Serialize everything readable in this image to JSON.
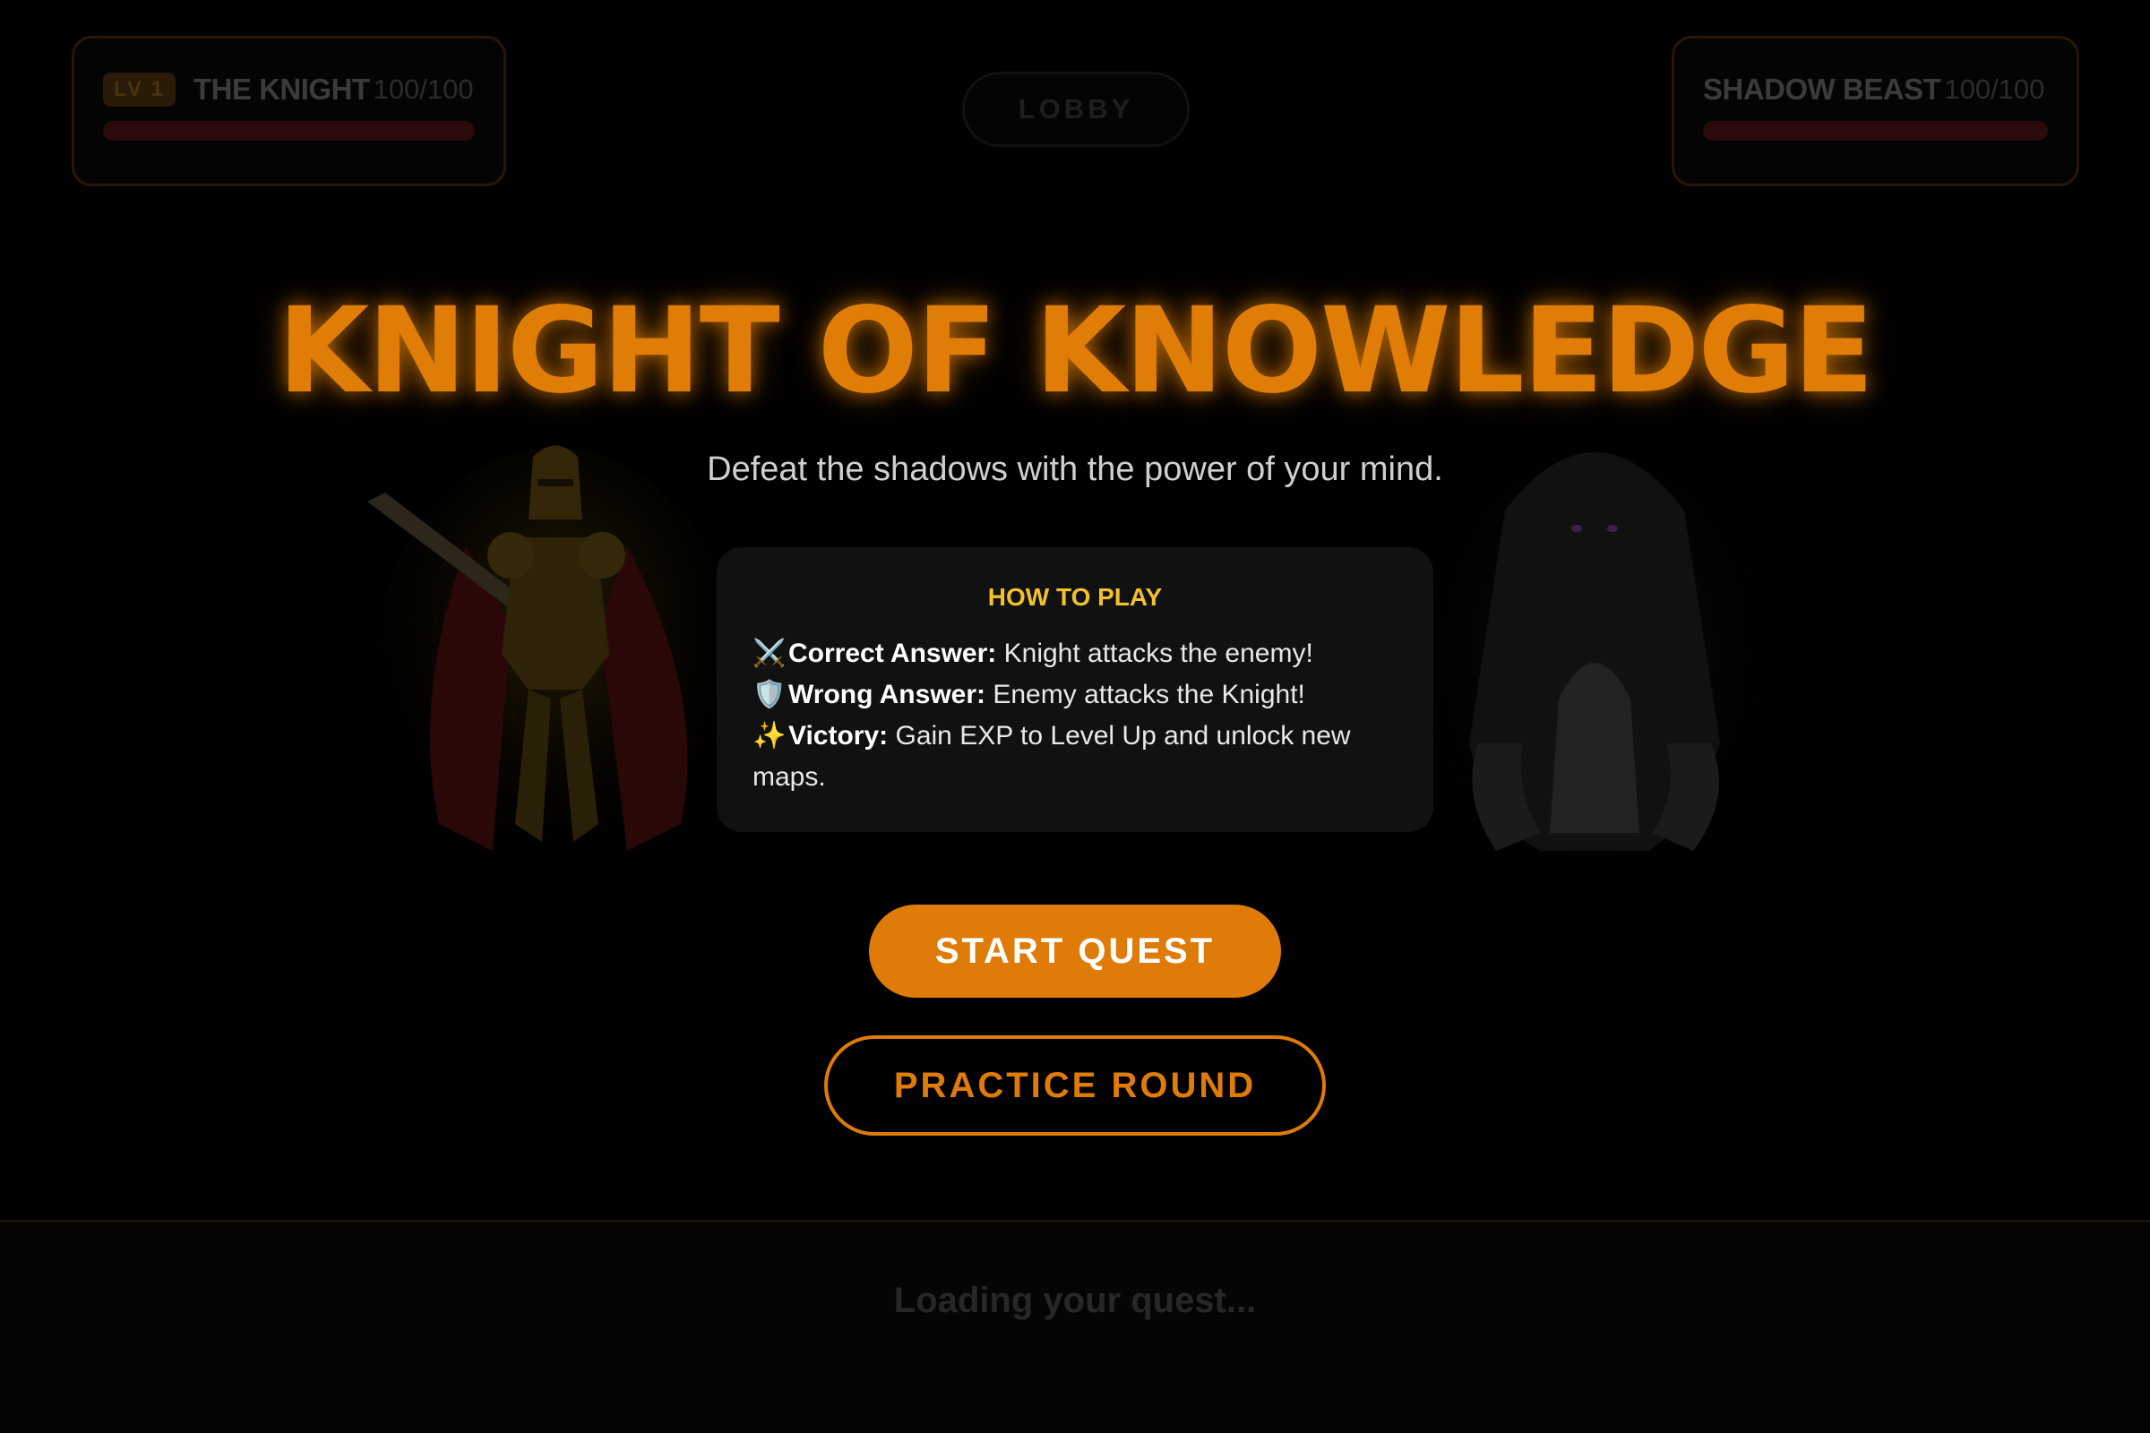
{
  "hud": {
    "player": {
      "level": "LV 1",
      "name": "THE KNIGHT",
      "hp": "100/100"
    },
    "enemy": {
      "name": "SHADOW BEAST",
      "hp": "100/100"
    },
    "lobby_label": "LOBBY"
  },
  "intro": {
    "title": "KNIGHT OF KNOWLEDGE",
    "subtitle": "Defeat the shadows with the power of your mind."
  },
  "how_to_play": {
    "heading": "HOW TO PLAY",
    "rules": [
      {
        "icon": "⚔️",
        "label": "Correct Answer:",
        "text": "Knight attacks the enemy!"
      },
      {
        "icon": "🛡️",
        "label": "Wrong Answer:",
        "text": "Enemy attacks the Knight!"
      },
      {
        "icon": "✨",
        "label": "Victory:",
        "text": "Gain EXP to Level Up and unlock new maps."
      }
    ]
  },
  "actions": {
    "start_label": "START QUEST",
    "practice_label": "PRACTICE ROUND"
  },
  "status": {
    "loading_text": "Loading your quest..."
  },
  "colors": {
    "accent": "#df7b08",
    "heading_yellow": "#f2c12e",
    "background": "#000000"
  },
  "icons": {
    "rule1": "crossed-swords-icon",
    "rule2": "shield-icon",
    "rule3": "sparkles-icon"
  }
}
